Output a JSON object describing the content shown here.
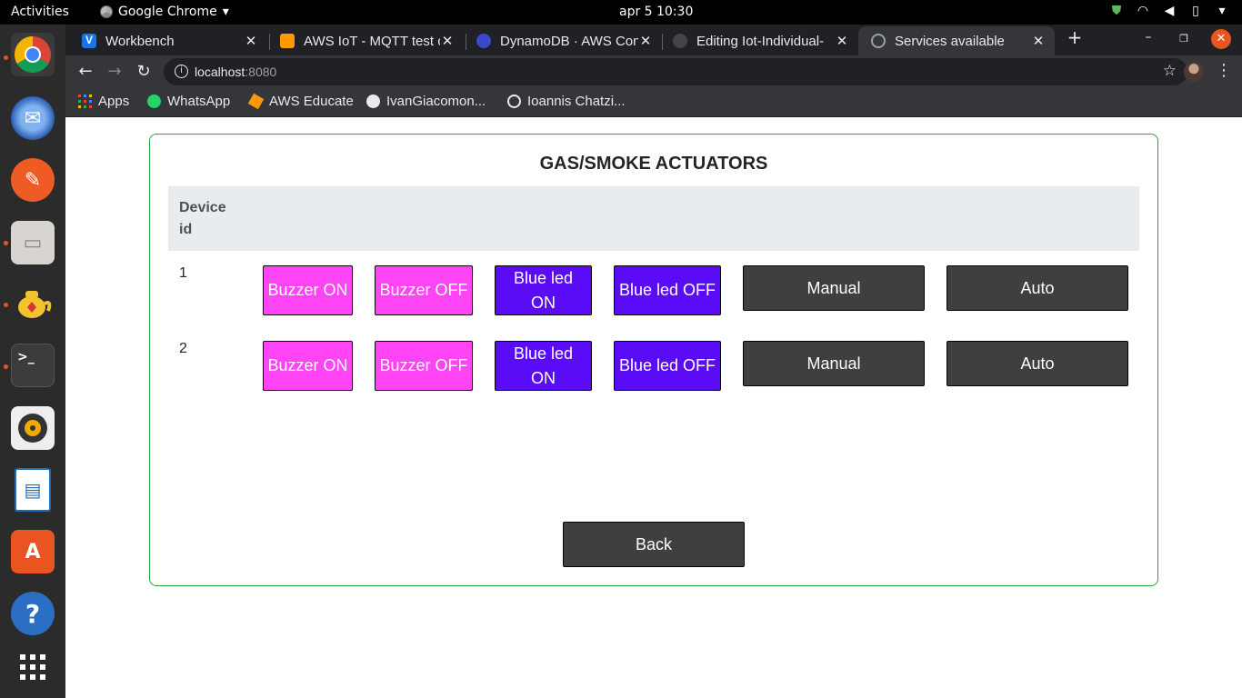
{
  "system": {
    "activities": "Activities",
    "app_name": "Google Chrome",
    "app_menu_arrow": "▾",
    "clock": "apr 5  10:30"
  },
  "tabs": [
    {
      "label": "Workbench",
      "icon_color": "#1a73e8"
    },
    {
      "label": "AWS IoT - MQTT test cl",
      "icon_color": "#ff9900"
    },
    {
      "label": "DynamoDB · AWS Con",
      "icon_color": "#3b48cc"
    },
    {
      "label": "Editing Iot-Individual-",
      "icon_color": "#444"
    },
    {
      "label": "Services available",
      "icon_color": "#9aa0a6"
    }
  ],
  "address_bar": {
    "host": "localhost",
    "port": ":8080"
  },
  "bookmarks": [
    {
      "label": "Apps"
    },
    {
      "label": "WhatsApp"
    },
    {
      "label": "AWS Educate"
    },
    {
      "label": "IvanGiacomon..."
    },
    {
      "label": "Ioannis Chatzi..."
    }
  ],
  "page": {
    "title": "GAS/SMOKE ACTUATORS",
    "column_header": "Device id",
    "devices": [
      {
        "id": "1",
        "buttons": [
          "Buzzer ON",
          "Buzzer OFF",
          "Blue led ON",
          "Blue led OFF",
          "Manual",
          "Auto"
        ]
      },
      {
        "id": "2",
        "buttons": [
          "Buzzer ON",
          "Buzzer OFF",
          "Blue led ON",
          "Blue led OFF",
          "Manual",
          "Auto"
        ]
      }
    ],
    "back_label": "Back",
    "colors": {
      "buzzer": "#ff44f6",
      "led": "#5b0cf7",
      "mode": "#3f3f3f",
      "panel_border": "#28a745"
    }
  }
}
